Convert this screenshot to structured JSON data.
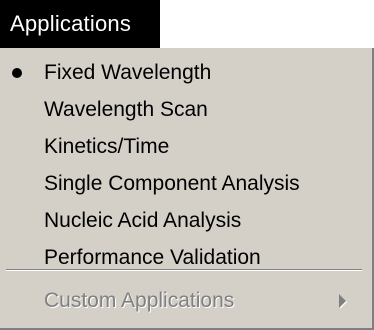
{
  "menu": {
    "title": "Applications",
    "items": [
      {
        "label": "Fixed Wavelength",
        "checked": true
      },
      {
        "label": "Wavelength Scan",
        "checked": false
      },
      {
        "label": "Kinetics/Time",
        "checked": false
      },
      {
        "label": "Single Component Analysis",
        "checked": false
      },
      {
        "label": "Nucleic Acid Analysis",
        "checked": false
      },
      {
        "label": "Performance Validation",
        "checked": false
      }
    ],
    "submenu": {
      "label": "Custom Applications",
      "disabled": true,
      "arrow_icon": "chevron-right-icon"
    }
  },
  "colors": {
    "title_bg": "#000000",
    "title_text": "#ffffff",
    "menu_bg": "#d4d0c8",
    "disabled_text": "#808080"
  }
}
